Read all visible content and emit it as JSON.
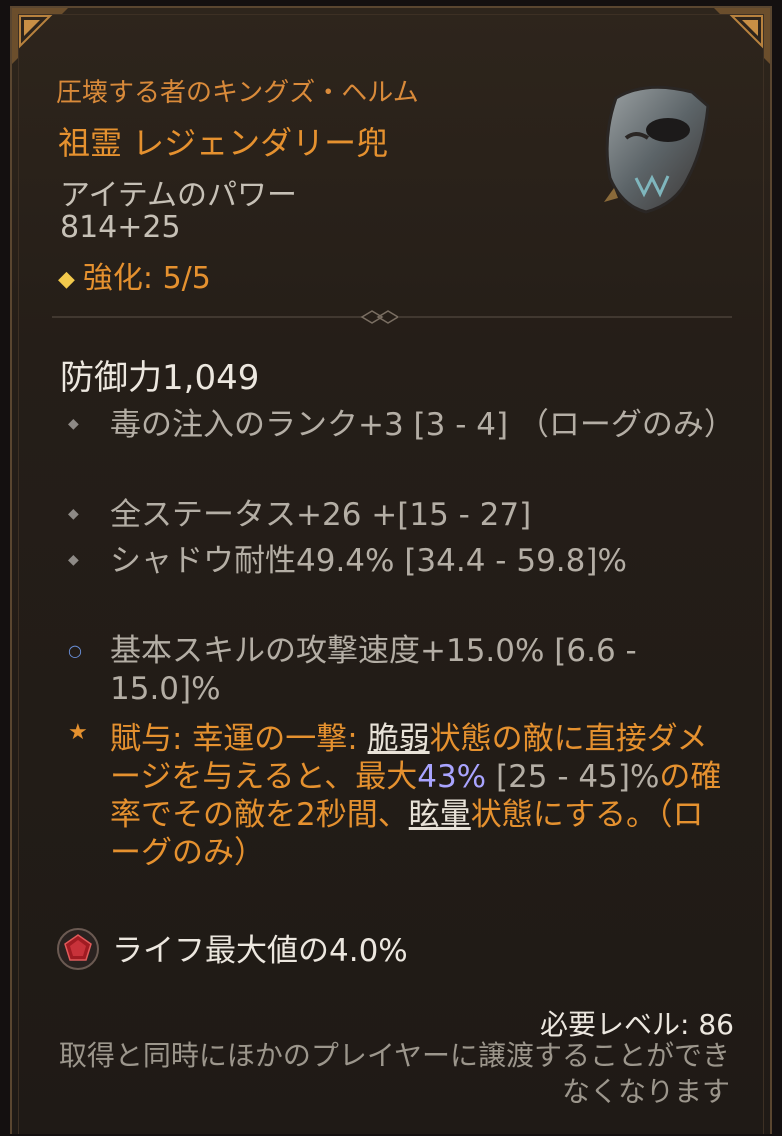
{
  "item": {
    "name": "圧壊する者のキングズ・ヘルム",
    "rarity_type": "祖霊 レジェンダリー兜",
    "power_label": "アイテムのパワー",
    "power_value": "814+25",
    "upgrade_label": "強化: 5/5",
    "icon": "helm-icon"
  },
  "stats": {
    "defense": "防御力1,049",
    "affixes": [
      {
        "icon": "gray-diamond",
        "text": "毒の注入のランク+3 [3 - 4] （ローグのみ）"
      },
      {
        "icon": "gray-diamond",
        "text": "全ステータス+26 +[15 - 27]"
      },
      {
        "icon": "gray-diamond",
        "text": "シャドウ耐性49.4% [34.4 - 59.8]%"
      },
      {
        "icon": "blue-ring",
        "text": "基本スキルの攻撃速度+15.0% [6.6 - 15.0]%"
      }
    ],
    "legendary": {
      "icon": "star",
      "prefix": "賦与: 幸運の一撃: ",
      "kw1": "脆弱",
      "part2": "状態の敵に直接ダメージを与えると、最大",
      "value": "43%",
      "range": " [25 - 45]%",
      "part3": "の確率でその敵を2秒間、",
      "kw2": "眩暈",
      "part4": "状態にする。（ローグのみ）"
    },
    "socket": {
      "icon": "ruby-gem-icon",
      "text": "ライフ最大値の4.0%"
    }
  },
  "footer": {
    "required_level": "必要レベル: 86",
    "note": "取得と同時にほかのプレイヤーに譲渡することができなくなります"
  },
  "colors": {
    "accent": "#e5912f",
    "highlight_value": "#a9a4ff",
    "body_text": "#b4aea5"
  }
}
